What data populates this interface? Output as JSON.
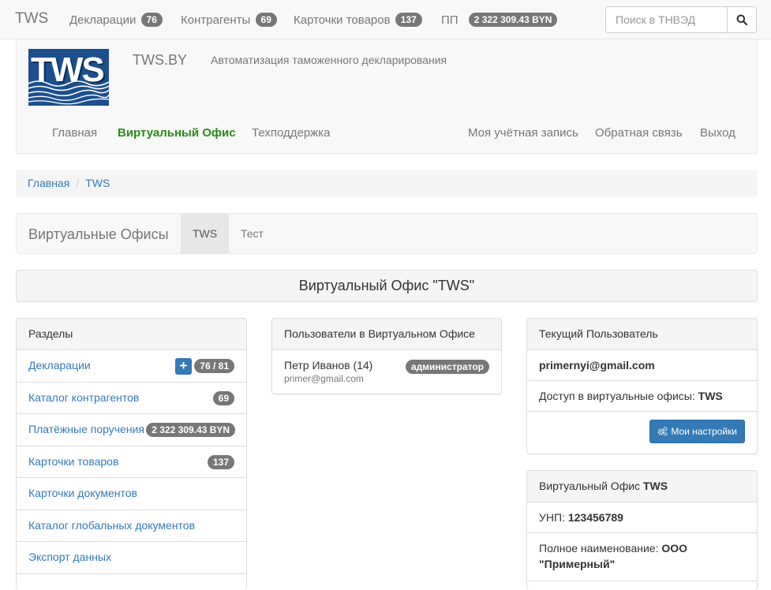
{
  "navbar": {
    "brand": "TWS",
    "items": [
      {
        "label": "Декларации",
        "badge": "76"
      },
      {
        "label": "Контрагенты",
        "badge": "69"
      },
      {
        "label": "Карточки товаров",
        "badge": "137"
      },
      {
        "label": "ПП",
        "badge": "2 322 309.43 BYN"
      }
    ],
    "search": {
      "placeholder": "Поиск в ТНВЭД",
      "icon": "search-icon"
    }
  },
  "header": {
    "logo_text": "TWS",
    "site_name": "TWS.BY",
    "description": "Автоматизация таможенного декларирования",
    "nav_left": [
      "Главная",
      "Виртуальный Офис",
      "Техподдержка"
    ],
    "nav_right": [
      "Моя учётная запись",
      "Обратная связь",
      "Выход"
    ],
    "active_color": "#2a8a16"
  },
  "breadcrumb": [
    "Главная",
    "TWS"
  ],
  "offices": {
    "title": "Виртуальные Офисы",
    "tabs": [
      "TWS",
      "Тест"
    ]
  },
  "office_title": "Виртуальный Офис \"TWS\"",
  "sections": {
    "heading": "Разделы",
    "items": [
      {
        "label": "Декларации",
        "badge": "76 / 81",
        "plus": "+"
      },
      {
        "label": "Каталог контрагентов",
        "badge": "69"
      },
      {
        "label": "Платёжные поручения",
        "badge": "2 322 309.43 BYN"
      },
      {
        "label": "Карточки товаров",
        "badge": "137"
      },
      {
        "label": "Карточки документов"
      },
      {
        "label": "Каталог глобальных документов"
      },
      {
        "label": "Экспорт данных"
      }
    ]
  },
  "users_panel": {
    "heading": "Пользователи в Виртуальном Офисе",
    "users": [
      {
        "name": "Петр Иванов (14)",
        "email": "primer@gmail.com",
        "role": "администратор"
      }
    ]
  },
  "current_user": {
    "heading": "Текущий Пользователь",
    "email": "primernyi@gmail.com",
    "access_label": "Доступ в виртуальные офисы:",
    "access_value": "TWS",
    "settings_button": "Мои настройки",
    "settings_icon": "gears-icon"
  },
  "office_info": {
    "heading_prefix": "Виртуальный Офис",
    "heading_name": "TWS",
    "unp_label": "УНП:",
    "unp_value": "123456789",
    "fullname_label": "Полное наименование:",
    "fullname_value": "ООО \"Примерный\""
  },
  "colors": {
    "link": "#337ab7",
    "badge": "#777777",
    "primary": "#337ab7",
    "logo_bg": "#1d4f8d"
  }
}
